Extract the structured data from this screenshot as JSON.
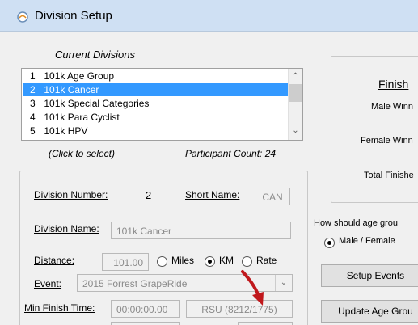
{
  "window": {
    "title": "Division Setup",
    "accent": "#cfe0f3"
  },
  "divisions": {
    "header": "Current Divisions",
    "items": [
      {
        "num": "1",
        "name": "101k Age Group"
      },
      {
        "num": "2",
        "name": "101k Cancer"
      },
      {
        "num": "3",
        "name": "101k Special Categories"
      },
      {
        "num": "4",
        "name": "101k Para Cyclist"
      },
      {
        "num": "5",
        "name": "101k HPV"
      }
    ],
    "selected_index": 1,
    "hint": "(Click to select)",
    "participant_count": "Participant Count: 24",
    "selected_color": "#3399ff"
  },
  "details": {
    "division_number_label": "Division Number:",
    "division_number": "2",
    "short_name_label": "Short Name:",
    "short_name": "CAN",
    "division_name_label": "Division Name:",
    "division_name": "101k Cancer",
    "distance_label": "Distance:",
    "distance": "101.00",
    "units": [
      "Miles",
      "KM",
      "Rate"
    ],
    "units_selected": "KM",
    "event_label": "Event:",
    "event": "2015 Forrest GrapeRide",
    "min_finish_label": "Min Finish Time:",
    "min_finish": "00:00:00.00",
    "rsu": "RSU (8212/1775)"
  },
  "finish": {
    "title": "Finish",
    "male": "Male Winn",
    "female": "Female Winn",
    "total": "Total Finishe"
  },
  "age_group": {
    "question": "How should age grou",
    "option": "Male / Female",
    "setup_events": "Setup Events",
    "update_age": "Update Age Grou"
  },
  "arrow_color": "#c0181c"
}
